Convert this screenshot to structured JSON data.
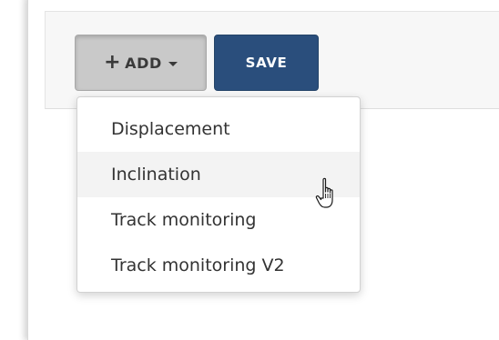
{
  "toolbar": {
    "add_label": "ADD",
    "add_plus": "+",
    "save_label": "SAVE"
  },
  "add_menu": {
    "items": [
      {
        "label": "Displacement"
      },
      {
        "label": "Inclination",
        "hovered": true
      },
      {
        "label": "Track monitoring"
      },
      {
        "label": "Track monitoring V2"
      }
    ]
  },
  "icons": {
    "cursor": "hand-pointer-icon",
    "caret": "caret-down-icon"
  },
  "colors": {
    "save_button": "#2a4e7c",
    "add_button": "#c9c9c9",
    "menu_hover": "#f3f3f3",
    "text": "#333333"
  }
}
